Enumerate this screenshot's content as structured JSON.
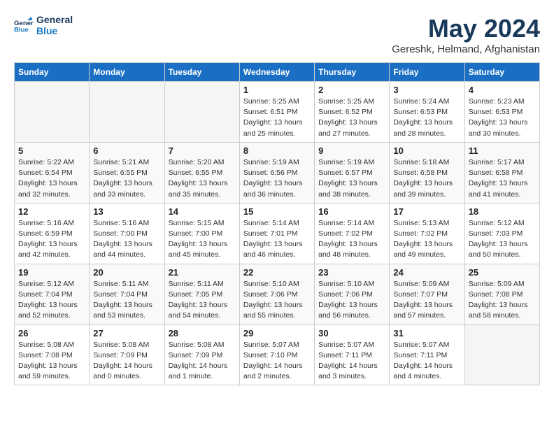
{
  "logo": {
    "line1": "General",
    "line2": "Blue"
  },
  "title": "May 2024",
  "subtitle": "Gereshk, Helmand, Afghanistan",
  "weekdays": [
    "Sunday",
    "Monday",
    "Tuesday",
    "Wednesday",
    "Thursday",
    "Friday",
    "Saturday"
  ],
  "weeks": [
    [
      {
        "day": "",
        "info": ""
      },
      {
        "day": "",
        "info": ""
      },
      {
        "day": "",
        "info": ""
      },
      {
        "day": "1",
        "info": "Sunrise: 5:25 AM\nSunset: 6:51 PM\nDaylight: 13 hours\nand 25 minutes."
      },
      {
        "day": "2",
        "info": "Sunrise: 5:25 AM\nSunset: 6:52 PM\nDaylight: 13 hours\nand 27 minutes."
      },
      {
        "day": "3",
        "info": "Sunrise: 5:24 AM\nSunset: 6:53 PM\nDaylight: 13 hours\nand 28 minutes."
      },
      {
        "day": "4",
        "info": "Sunrise: 5:23 AM\nSunset: 6:53 PM\nDaylight: 13 hours\nand 30 minutes."
      }
    ],
    [
      {
        "day": "5",
        "info": "Sunrise: 5:22 AM\nSunset: 6:54 PM\nDaylight: 13 hours\nand 32 minutes."
      },
      {
        "day": "6",
        "info": "Sunrise: 5:21 AM\nSunset: 6:55 PM\nDaylight: 13 hours\nand 33 minutes."
      },
      {
        "day": "7",
        "info": "Sunrise: 5:20 AM\nSunset: 6:55 PM\nDaylight: 13 hours\nand 35 minutes."
      },
      {
        "day": "8",
        "info": "Sunrise: 5:19 AM\nSunset: 6:56 PM\nDaylight: 13 hours\nand 36 minutes."
      },
      {
        "day": "9",
        "info": "Sunrise: 5:19 AM\nSunset: 6:57 PM\nDaylight: 13 hours\nand 38 minutes."
      },
      {
        "day": "10",
        "info": "Sunrise: 5:18 AM\nSunset: 6:58 PM\nDaylight: 13 hours\nand 39 minutes."
      },
      {
        "day": "11",
        "info": "Sunrise: 5:17 AM\nSunset: 6:58 PM\nDaylight: 13 hours\nand 41 minutes."
      }
    ],
    [
      {
        "day": "12",
        "info": "Sunrise: 5:16 AM\nSunset: 6:59 PM\nDaylight: 13 hours\nand 42 minutes."
      },
      {
        "day": "13",
        "info": "Sunrise: 5:16 AM\nSunset: 7:00 PM\nDaylight: 13 hours\nand 44 minutes."
      },
      {
        "day": "14",
        "info": "Sunrise: 5:15 AM\nSunset: 7:00 PM\nDaylight: 13 hours\nand 45 minutes."
      },
      {
        "day": "15",
        "info": "Sunrise: 5:14 AM\nSunset: 7:01 PM\nDaylight: 13 hours\nand 46 minutes."
      },
      {
        "day": "16",
        "info": "Sunrise: 5:14 AM\nSunset: 7:02 PM\nDaylight: 13 hours\nand 48 minutes."
      },
      {
        "day": "17",
        "info": "Sunrise: 5:13 AM\nSunset: 7:02 PM\nDaylight: 13 hours\nand 49 minutes."
      },
      {
        "day": "18",
        "info": "Sunrise: 5:12 AM\nSunset: 7:03 PM\nDaylight: 13 hours\nand 50 minutes."
      }
    ],
    [
      {
        "day": "19",
        "info": "Sunrise: 5:12 AM\nSunset: 7:04 PM\nDaylight: 13 hours\nand 52 minutes."
      },
      {
        "day": "20",
        "info": "Sunrise: 5:11 AM\nSunset: 7:04 PM\nDaylight: 13 hours\nand 53 minutes."
      },
      {
        "day": "21",
        "info": "Sunrise: 5:11 AM\nSunset: 7:05 PM\nDaylight: 13 hours\nand 54 minutes."
      },
      {
        "day": "22",
        "info": "Sunrise: 5:10 AM\nSunset: 7:06 PM\nDaylight: 13 hours\nand 55 minutes."
      },
      {
        "day": "23",
        "info": "Sunrise: 5:10 AM\nSunset: 7:06 PM\nDaylight: 13 hours\nand 56 minutes."
      },
      {
        "day": "24",
        "info": "Sunrise: 5:09 AM\nSunset: 7:07 PM\nDaylight: 13 hours\nand 57 minutes."
      },
      {
        "day": "25",
        "info": "Sunrise: 5:09 AM\nSunset: 7:08 PM\nDaylight: 13 hours\nand 58 minutes."
      }
    ],
    [
      {
        "day": "26",
        "info": "Sunrise: 5:08 AM\nSunset: 7:08 PM\nDaylight: 13 hours\nand 59 minutes."
      },
      {
        "day": "27",
        "info": "Sunrise: 5:08 AM\nSunset: 7:09 PM\nDaylight: 14 hours\nand 0 minutes."
      },
      {
        "day": "28",
        "info": "Sunrise: 5:08 AM\nSunset: 7:09 PM\nDaylight: 14 hours\nand 1 minute."
      },
      {
        "day": "29",
        "info": "Sunrise: 5:07 AM\nSunset: 7:10 PM\nDaylight: 14 hours\nand 2 minutes."
      },
      {
        "day": "30",
        "info": "Sunrise: 5:07 AM\nSunset: 7:11 PM\nDaylight: 14 hours\nand 3 minutes."
      },
      {
        "day": "31",
        "info": "Sunrise: 5:07 AM\nSunset: 7:11 PM\nDaylight: 14 hours\nand 4 minutes."
      },
      {
        "day": "",
        "info": ""
      }
    ]
  ]
}
